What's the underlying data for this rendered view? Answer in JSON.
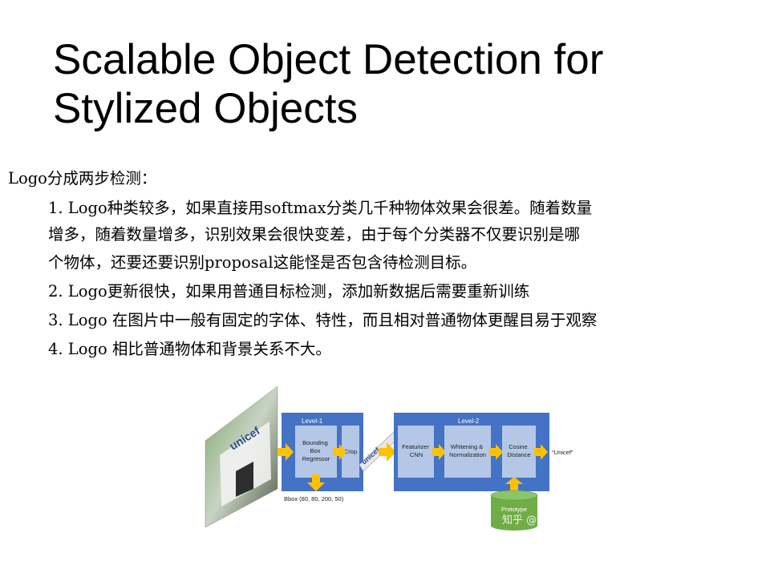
{
  "slide": {
    "title_line1": "Scalable Object Detection for",
    "title_line2": "Stylized Objects",
    "intro": "Logo分成两步检测：",
    "lines": [
      "1. Logo种类较多，如果直接用softmax分类几千种物体效果会很差。随着数量",
      "增多，随着数量增多，识别效果会很快变差，由于每个分类器不仅要识别是哪",
      "个物体，还要还要识别proposal这能怪是否包含待检测目标。",
      "2. Logo更新很快，如果用普通目标检测，添加新数据后需要重新训练",
      "3. Logo 在图片中一般有固定的字体、特性，而且相对普通物体更醒目易于观察",
      "4. Logo 相比普通物体和背景关系不大。"
    ]
  },
  "figure": {
    "level1_label": "Level-1",
    "level2_label": "Level-2",
    "bbox_regressor_lines": [
      "Bounding",
      "Box",
      "Regressor"
    ],
    "crop_label": "Crop",
    "featurizer_lines": [
      "Featurizer",
      "CNN"
    ],
    "whitening_lines": [
      "Whitening &",
      "Normalization"
    ],
    "cosine_lines": [
      "Cosine",
      "Distance"
    ],
    "output_label": "\"Unicef\"",
    "bbox_caption": "Bbox (80, 80, 200, 50)",
    "prototype_label": "Prototype",
    "photo_text": "unicef",
    "crop_text": "unicef",
    "watermark": "知乎 @vision",
    "colors": {
      "panel_blue": "#4472c4",
      "box_fill": "#b4c7e7",
      "arrow_yellow": "#ffc000",
      "db_green": "#70ad47"
    }
  }
}
